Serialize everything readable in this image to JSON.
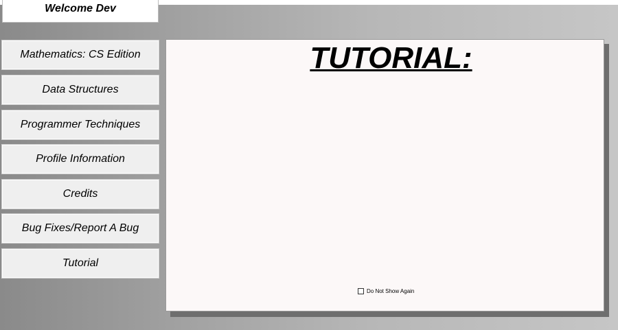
{
  "header": {
    "welcome_text": "Welcome Dev"
  },
  "nav": {
    "items": [
      {
        "label": "Mathematics: CS Edition"
      },
      {
        "label": "Data Structures"
      },
      {
        "label": "Programmer Techniques"
      },
      {
        "label": "Profile Information"
      },
      {
        "label": "Credits"
      },
      {
        "label": "Bug Fixes/Report A Bug"
      },
      {
        "label": "Tutorial"
      }
    ]
  },
  "tutorial_panel": {
    "title": "TUTORIAL:",
    "dont_show_label": "Do Not Show Again",
    "dont_show_checked": false
  },
  "colors": {
    "panel_bg": "#fcf8f8",
    "button_bg": "#efefef",
    "shadow": "#6e6e6e"
  },
  "icons": {
    "checkbox": "checkbox-unchecked-icon"
  }
}
